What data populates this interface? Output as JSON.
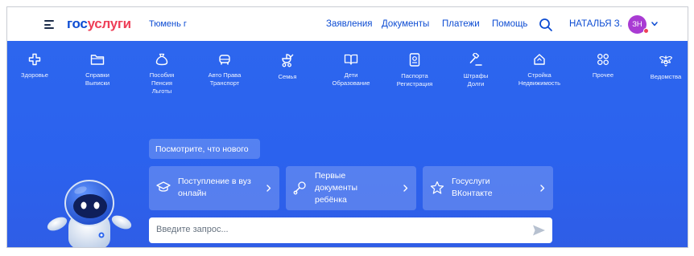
{
  "header": {
    "logo_part1": "гос",
    "logo_part2": "услуги",
    "city": "Тюмень г",
    "nav": [
      "Заявления",
      "Документы",
      "Платежи",
      "Помощь"
    ],
    "user_name": "НАТАЛЬЯ З.",
    "avatar_initials": "ЗН",
    "icons": {
      "menu": "hamburger-icon",
      "search": "search-icon",
      "chevron": "chevron-down-icon"
    }
  },
  "categories": [
    {
      "label": "Здоровье",
      "icon": "health-cross-icon"
    },
    {
      "label": "Справки\nВыписки",
      "icon": "folder-icon"
    },
    {
      "label": "Пособия\nПенсия\nЛьготы",
      "icon": "money-bag-icon"
    },
    {
      "label": "Авто Права\nТранспорт",
      "icon": "car-icon"
    },
    {
      "label": "Семья",
      "icon": "stroller-icon"
    },
    {
      "label": "Дети\nОбразование",
      "icon": "book-icon"
    },
    {
      "label": "Паспорта\nРегистрация",
      "icon": "passport-icon"
    },
    {
      "label": "Штрафы\nДолги",
      "icon": "gavel-icon"
    },
    {
      "label": "Стройка\nНедвижимость",
      "icon": "house-icon"
    },
    {
      "label": "Прочее",
      "icon": "grid-icon"
    },
    {
      "label": "Ведомства",
      "icon": "coat-of-arms-icon"
    }
  ],
  "hero": {
    "what_new": "Посмотрите, что нового",
    "cards": [
      {
        "line1": "Поступление в вуз",
        "line2": "онлайн",
        "line3": "",
        "icon": "graduation-cap-icon"
      },
      {
        "line1": "Первые",
        "line2": "документы",
        "line3": "ребёнка",
        "icon": "rattle-icon"
      },
      {
        "line1": "Госуслуги",
        "line2": "ВКонтакте",
        "line3": "",
        "icon": "star-icon"
      }
    ],
    "search_placeholder": "Введите запрос...",
    "send_icon": "send-arrow-icon",
    "mascot": "robot-mascot-icon"
  },
  "colors": {
    "brand_blue": "#0d4cd3",
    "brand_red": "#ee3f58",
    "hero_blue": "#2d66ee",
    "avatar": "#a93bd3"
  }
}
